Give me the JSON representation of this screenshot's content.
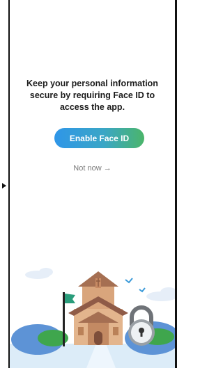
{
  "prompt": {
    "message": "Keep your personal information secure by requiring Face ID to access the app."
  },
  "actions": {
    "enable_label": "Enable Face ID",
    "skip_label": "Not now →"
  },
  "colors": {
    "button_gradient": [
      "#2f96e8",
      "#4bb56a"
    ],
    "frame": "#111111"
  },
  "icons": [
    "arrow-right-icon",
    "lock-icon",
    "flag-icon",
    "bird-icon"
  ]
}
